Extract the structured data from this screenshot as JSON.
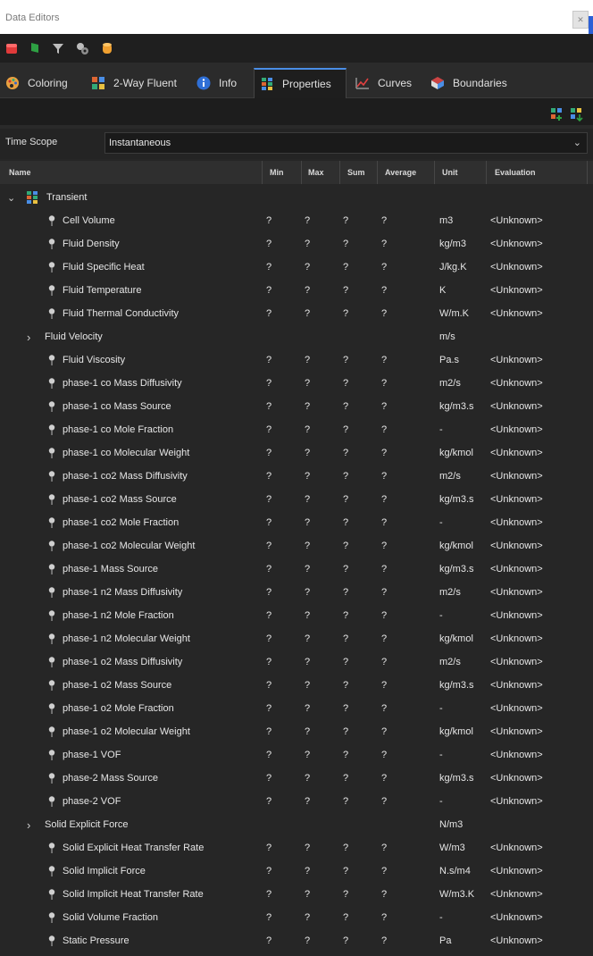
{
  "window": {
    "title": "Data Editors",
    "close_icon": "close-icon"
  },
  "toolbar": {
    "buttons": [
      {
        "name": "red-cube-icon",
        "color": "#e03a3a"
      },
      {
        "name": "green-flag-icon",
        "color": "#2ea043"
      },
      {
        "name": "filter-icon",
        "color": "#bdbdbd"
      },
      {
        "name": "settings-group-icon",
        "color": "#bdbdbd"
      },
      {
        "name": "orange-cylinder-icon",
        "color": "#f0a030"
      }
    ]
  },
  "tabs": [
    {
      "label": "Coloring",
      "icon": "palette-icon",
      "active": false
    },
    {
      "label": "2-Way Fluent",
      "icon": "two-way-fluent-icon",
      "active": false
    },
    {
      "label": "Info",
      "icon": "info-icon",
      "active": false
    },
    {
      "label": "Properties",
      "icon": "properties-icon",
      "active": true
    },
    {
      "label": "Curves",
      "icon": "curves-icon",
      "active": false
    },
    {
      "label": "Boundaries",
      "icon": "boundaries-icon",
      "active": false
    }
  ],
  "time_scope": {
    "label": "Time Scope",
    "value": "Instantaneous"
  },
  "columns": [
    "Name",
    "Min",
    "Max",
    "Sum",
    "Average",
    "Unit",
    "Evaluation"
  ],
  "group": {
    "label": "Transient",
    "expanded": true
  },
  "rows": [
    {
      "name": "Cell Volume",
      "min": "?",
      "max": "?",
      "sum": "?",
      "avg": "?",
      "unit": "m3",
      "eval": "<Unknown>"
    },
    {
      "name": "Fluid Density",
      "min": "?",
      "max": "?",
      "sum": "?",
      "avg": "?",
      "unit": "kg/m3",
      "eval": "<Unknown>"
    },
    {
      "name": "Fluid Specific Heat",
      "min": "?",
      "max": "?",
      "sum": "?",
      "avg": "?",
      "unit": "J/kg.K",
      "eval": "<Unknown>"
    },
    {
      "name": "Fluid Temperature",
      "min": "?",
      "max": "?",
      "sum": "?",
      "avg": "?",
      "unit": "K",
      "eval": "<Unknown>"
    },
    {
      "name": "Fluid Thermal Conductivity",
      "min": "?",
      "max": "?",
      "sum": "?",
      "avg": "?",
      "unit": "W/m.K",
      "eval": "<Unknown>"
    },
    {
      "name": "Fluid Velocity",
      "expandable": true,
      "min": "",
      "max": "",
      "sum": "",
      "avg": "",
      "unit": "m/s",
      "eval": ""
    },
    {
      "name": "Fluid Viscosity",
      "min": "?",
      "max": "?",
      "sum": "?",
      "avg": "?",
      "unit": "Pa.s",
      "eval": "<Unknown>"
    },
    {
      "name": "phase-1 co Mass Diffusivity",
      "min": "?",
      "max": "?",
      "sum": "?",
      "avg": "?",
      "unit": "m2/s",
      "eval": "<Unknown>"
    },
    {
      "name": "phase-1 co Mass Source",
      "min": "?",
      "max": "?",
      "sum": "?",
      "avg": "?",
      "unit": "kg/m3.s",
      "eval": "<Unknown>"
    },
    {
      "name": "phase-1 co Mole Fraction",
      "min": "?",
      "max": "?",
      "sum": "?",
      "avg": "?",
      "unit": "-",
      "eval": "<Unknown>"
    },
    {
      "name": "phase-1 co Molecular Weight",
      "min": "?",
      "max": "?",
      "sum": "?",
      "avg": "?",
      "unit": "kg/kmol",
      "eval": "<Unknown>"
    },
    {
      "name": "phase-1 co2 Mass Diffusivity",
      "min": "?",
      "max": "?",
      "sum": "?",
      "avg": "?",
      "unit": "m2/s",
      "eval": "<Unknown>"
    },
    {
      "name": "phase-1 co2 Mass Source",
      "min": "?",
      "max": "?",
      "sum": "?",
      "avg": "?",
      "unit": "kg/m3.s",
      "eval": "<Unknown>"
    },
    {
      "name": "phase-1 co2 Mole Fraction",
      "min": "?",
      "max": "?",
      "sum": "?",
      "avg": "?",
      "unit": "-",
      "eval": "<Unknown>"
    },
    {
      "name": "phase-1 co2 Molecular Weight",
      "min": "?",
      "max": "?",
      "sum": "?",
      "avg": "?",
      "unit": "kg/kmol",
      "eval": "<Unknown>"
    },
    {
      "name": "phase-1 Mass Source",
      "min": "?",
      "max": "?",
      "sum": "?",
      "avg": "?",
      "unit": "kg/m3.s",
      "eval": "<Unknown>"
    },
    {
      "name": "phase-1 n2 Mass Diffusivity",
      "min": "?",
      "max": "?",
      "sum": "?",
      "avg": "?",
      "unit": "m2/s",
      "eval": "<Unknown>"
    },
    {
      "name": "phase-1 n2 Mole Fraction",
      "min": "?",
      "max": "?",
      "sum": "?",
      "avg": "?",
      "unit": "-",
      "eval": "<Unknown>"
    },
    {
      "name": "phase-1 n2 Molecular Weight",
      "min": "?",
      "max": "?",
      "sum": "?",
      "avg": "?",
      "unit": "kg/kmol",
      "eval": "<Unknown>"
    },
    {
      "name": "phase-1 o2 Mass Diffusivity",
      "min": "?",
      "max": "?",
      "sum": "?",
      "avg": "?",
      "unit": "m2/s",
      "eval": "<Unknown>"
    },
    {
      "name": "phase-1 o2 Mass Source",
      "min": "?",
      "max": "?",
      "sum": "?",
      "avg": "?",
      "unit": "kg/m3.s",
      "eval": "<Unknown>"
    },
    {
      "name": "phase-1 o2 Mole Fraction",
      "min": "?",
      "max": "?",
      "sum": "?",
      "avg": "?",
      "unit": "-",
      "eval": "<Unknown>"
    },
    {
      "name": "phase-1 o2 Molecular Weight",
      "min": "?",
      "max": "?",
      "sum": "?",
      "avg": "?",
      "unit": "kg/kmol",
      "eval": "<Unknown>"
    },
    {
      "name": "phase-1 VOF",
      "min": "?",
      "max": "?",
      "sum": "?",
      "avg": "?",
      "unit": "-",
      "eval": "<Unknown>"
    },
    {
      "name": "phase-2 Mass Source",
      "min": "?",
      "max": "?",
      "sum": "?",
      "avg": "?",
      "unit": "kg/m3.s",
      "eval": "<Unknown>"
    },
    {
      "name": "phase-2 VOF",
      "min": "?",
      "max": "?",
      "sum": "?",
      "avg": "?",
      "unit": "-",
      "eval": "<Unknown>"
    },
    {
      "name": "Solid Explicit Force",
      "expandable": true,
      "min": "",
      "max": "",
      "sum": "",
      "avg": "",
      "unit": "N/m3",
      "eval": ""
    },
    {
      "name": "Solid Explicit Heat Transfer Rate",
      "min": "?",
      "max": "?",
      "sum": "?",
      "avg": "?",
      "unit": "W/m3",
      "eval": "<Unknown>"
    },
    {
      "name": "Solid Implicit Force",
      "min": "?",
      "max": "?",
      "sum": "?",
      "avg": "?",
      "unit": "N.s/m4",
      "eval": "<Unknown>"
    },
    {
      "name": "Solid Implicit Heat Transfer Rate",
      "min": "?",
      "max": "?",
      "sum": "?",
      "avg": "?",
      "unit": "W/m3.K",
      "eval": "<Unknown>"
    },
    {
      "name": "Solid Volume Fraction",
      "min": "?",
      "max": "?",
      "sum": "?",
      "avg": "?",
      "unit": "-",
      "eval": "<Unknown>"
    },
    {
      "name": "Static Pressure",
      "min": "?",
      "max": "?",
      "sum": "?",
      "avg": "?",
      "unit": "Pa",
      "eval": "<Unknown>"
    }
  ],
  "colors": {
    "accent": "#4a8ee6",
    "background": "#262626",
    "toolbar": "#1f1f1f"
  }
}
